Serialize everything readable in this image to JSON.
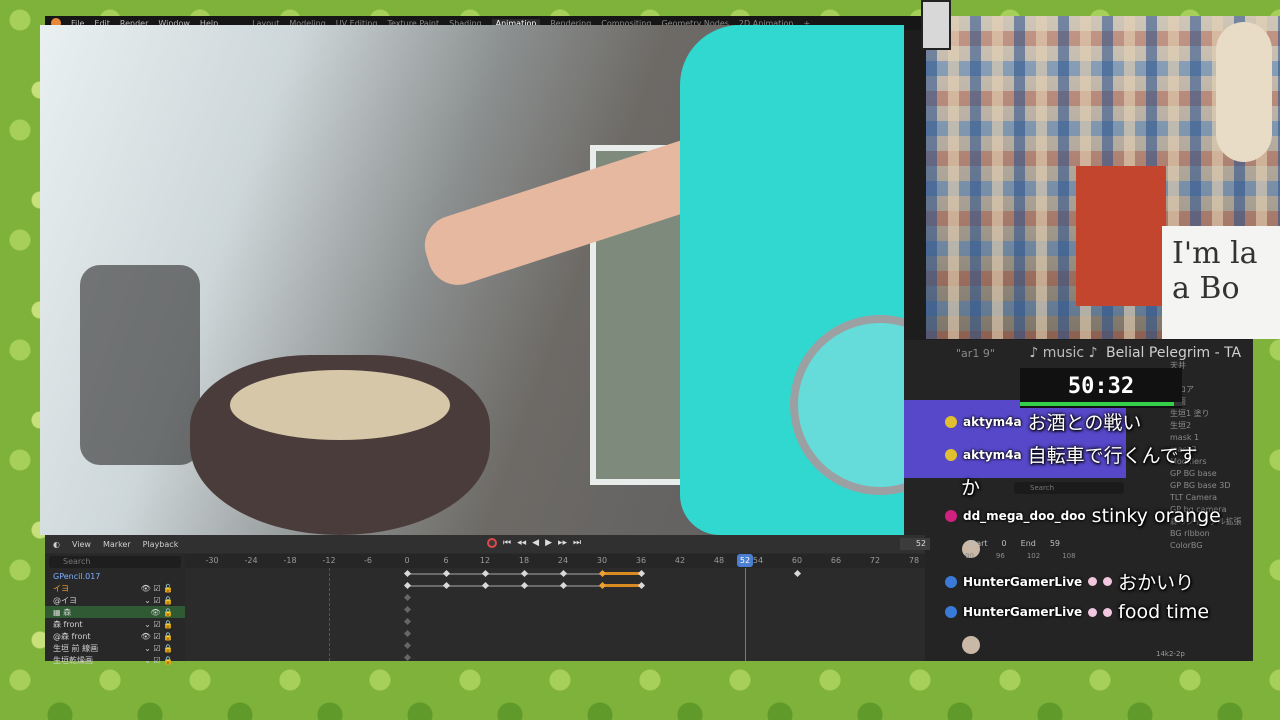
{
  "topbar": {
    "menus": [
      "File",
      "Edit",
      "Render",
      "Window",
      "Help"
    ],
    "workspaces": [
      "Layout",
      "Modeling",
      "UV Editing",
      "Texture Paint",
      "Shading",
      "Animation",
      "Rendering",
      "Compositing",
      "Geometry Nodes",
      "2D Animation",
      "+"
    ],
    "active_workspace": "Animation"
  },
  "overlay": {
    "music_prefix": "♪ music ♪",
    "music_title": "Belial Pelegrim - TA",
    "music_label": "\"ar1 9\"",
    "timer": "50:32",
    "timer_progress": 0.95
  },
  "chat": [
    {
      "user": "aktym4a",
      "message": "お酒との戦い",
      "badge_color": "#e0c030"
    },
    {
      "user": "aktym4a",
      "message": "自転車で行くんです",
      "badge_color": "#e0c030"
    },
    {
      "user": "",
      "message": "か",
      "badge_color": ""
    },
    {
      "user": "dd_mega_doo_doo",
      "message": "stinky orange",
      "badge_color": "#d02080"
    },
    {
      "user": "HunterGamerLive",
      "message": "おかいり",
      "badge_color": "#3a7ad8"
    },
    {
      "user": "HunterGamerLive",
      "message": "food time",
      "badge_color": "#3a7ad8"
    }
  ],
  "dopesheet": {
    "header": {
      "view": "View",
      "marker": "Marker",
      "playback": "Playback"
    },
    "current_frame": "52",
    "start_label": "Start",
    "start_value": "0",
    "end_label": "End",
    "end_value": "59",
    "ruler": [
      "-30",
      "-24",
      "-18",
      "-12",
      "-6",
      "0",
      "6",
      "12",
      "18",
      "24",
      "30",
      "36",
      "42",
      "48",
      "52",
      "54",
      "60",
      "66",
      "72",
      "78"
    ],
    "ruler_right": [
      "90",
      "96",
      "102",
      "108"
    ],
    "search_placeholder": "Search",
    "channels": [
      {
        "name": "GPencil.017",
        "style": "blue"
      },
      {
        "name": "イヨ",
        "style": "orange"
      },
      {
        "name": "@イヨ",
        "style": "normal"
      },
      {
        "name": "▦ 森",
        "style": "sel"
      },
      {
        "name": "森    front",
        "style": "normal"
      },
      {
        "name": "@森    front",
        "style": "normal"
      },
      {
        "name": "生垣 前 線画",
        "style": "normal"
      },
      {
        "name": "生垣乾燥画",
        "style": "normal"
      }
    ]
  },
  "outliner": {
    "items": [
      "天井",
      "窓",
      "フロア",
      "地面",
      "生垣1 塗り",
      "生垣2",
      "mask 1",
      "mask2",
      "Modifiers",
      "GP BG base",
      "GP BG base 3D",
      "TLT Camera",
      "GP bg camera",
      "森のジャングル拡張",
      "BG ribbon",
      "ColorBG"
    ],
    "search_placeholder": "Search",
    "resolution": "14k2-2p"
  },
  "search_mid_placeholder": "Search"
}
